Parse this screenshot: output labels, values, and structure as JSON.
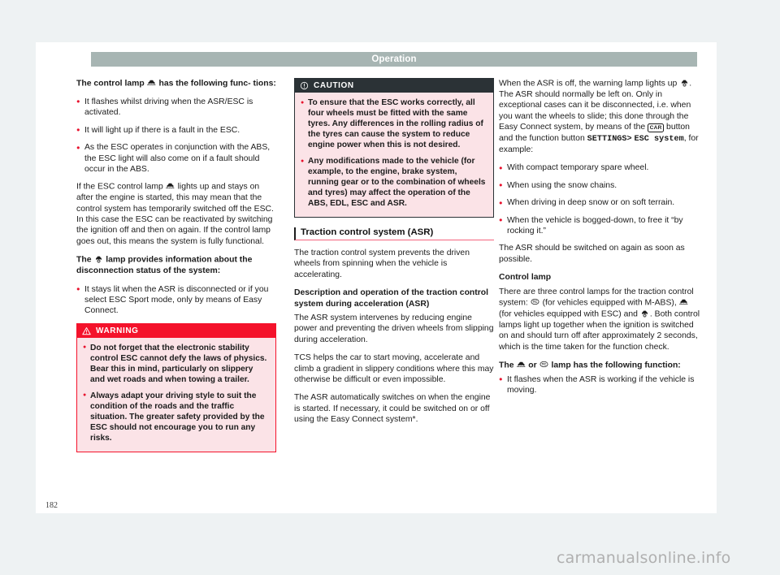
{
  "header": {
    "title": "Operation"
  },
  "folio": {
    "page_number": "182"
  },
  "watermark": {
    "text": "carmanualsonline.info"
  },
  "icons": {
    "esc_lamp": "esc-control-lamp-icon",
    "asr_lamp": "asr-control-lamp-icon",
    "tc_lamp": "tc-control-lamp-icon",
    "car_button": "CAR",
    "caution_icon": "exclamation-circle-icon",
    "warning_icon": "warning-triangle-icon"
  },
  "column1": {
    "heading1_a": "The control lamp",
    "heading1_b": "has the following func-",
    "heading1_c": "tions:",
    "bullets1": [
      "It flashes whilst driving when the ASR/ESC is activated.",
      "It will light up if there is a fault in the ESC.",
      "As the ESC operates in conjunction with the ABS, the ESC light will also come on if a fault should occur in the ABS."
    ],
    "para1_a": "If the ESC control lamp",
    "para1_b": "lights up and stays on after the engine is started, this may mean that the control system has temporarily switched off the ESC. In this case the ESC can be reactivated by switching the ignition off and then on again. If the control lamp goes out, this means the system is fully functional.",
    "heading2_a": "The",
    "heading2_b": "lamp provides information about the disconnection status of the system:",
    "bullets2": [
      "It stays lit when the ASR is disconnected or if you select ESC Sport mode, only by means of Easy Connect."
    ],
    "warning": {
      "label": "WARNING",
      "bullets": [
        "Do not forget that the electronic stability control ESC cannot defy the laws of physics. Bear this in mind, particularly on slippery and wet roads and when towing a trailer.",
        "Always adapt your driving style to suit the condition of the roads and the traffic situation. The greater safety provided by the ESC should not encourage you to run any risks."
      ]
    }
  },
  "column2": {
    "caution": {
      "label": "CAUTION",
      "bullets": [
        "To ensure that the ESC works correctly, all four wheels must be fitted with the same tyres. Any differences in the rolling radius of the tyres can cause the system to reduce engine power when this is not desired.",
        "Any modifications made to the vehicle (for example, to the engine, brake system, running gear or to the combination of wheels and tyres) may affect the operation of the ABS, EDL, ESC and ASR."
      ]
    },
    "section_title": "Traction control system (ASR)",
    "para1": "The traction control system prevents the driven wheels from spinning when the vehicle is accelerating.",
    "subhead1": "Description and operation of the traction control system during acceleration (ASR)",
    "para2": "The ASR system intervenes by reducing engine power and preventing the driven wheels from slipping during acceleration.",
    "para3": "TCS helps the car to start moving, accelerate and climb a gradient in slippery conditions where this may otherwise be difficult or even impossible.",
    "para4": "The ASR automatically switches on when the engine is started. If necessary, it could be switched on or off using the Easy Connect system*."
  },
  "column3": {
    "para1_a": "When the ASR is off, the warning lamp lights up",
    "para1_b": ". The ASR should normally be left on. Only in exceptional cases can it be disconnected, i.e. when you want the wheels to slide; this done through the Easy Connect system, by means of the",
    "para1_c": "button and the function button",
    "para1_settings": "SETTINGS>",
    "para1_esc": "ESC system",
    "para1_d": ", for example:",
    "bullets": [
      "With compact temporary spare wheel.",
      "When using the snow chains.",
      "When driving in deep snow or on soft terrain.",
      "When the vehicle is bogged-down, to free it “by rocking it.”"
    ],
    "para2": "The ASR should be switched on again as soon as possible.",
    "subhead1": "Control lamp",
    "para3_a": "There are three control lamps for the traction control system:",
    "para3_b": "(for vehicles equipped with M-ABS),",
    "para3_c": "(for vehicles equipped with ESC) and",
    "para3_d": ". Both control lamps light up together when the ignition is switched on and should turn off after approximately 2 seconds, which is the time taken for the function check.",
    "subhead2_a": "The",
    "subhead2_b": "or",
    "subhead2_c": "lamp has the following function:",
    "bullets2": [
      "It flashes when the ASR is working if the vehicle is moving."
    ]
  },
  "colors": {
    "accent_red": "#e8112d",
    "warning_red": "#f4122b",
    "caution_dark": "#2b3236",
    "header_gray": "#a7b5b3",
    "note_bg": "#fbe3e7"
  }
}
